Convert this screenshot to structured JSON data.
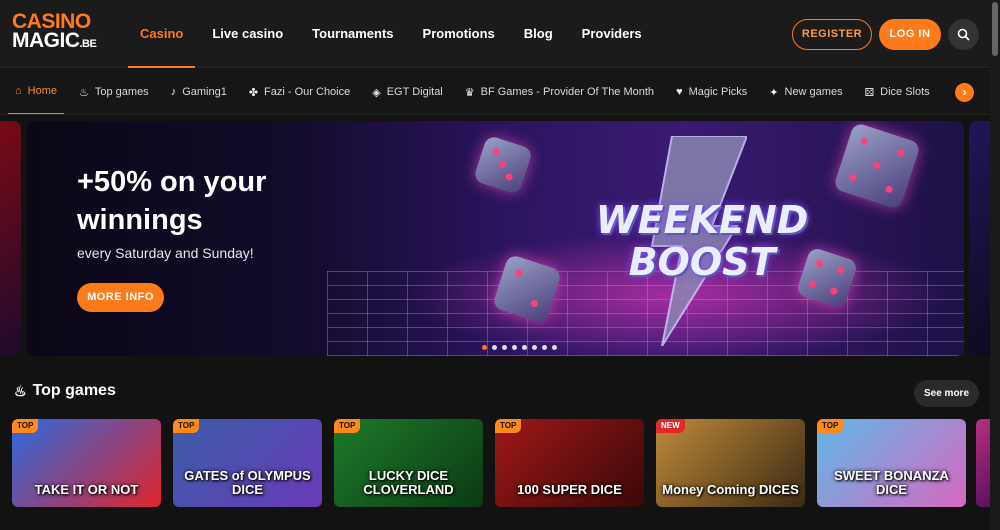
{
  "header": {
    "logo_line1": "CASINO",
    "logo_line2": "MAGIC",
    "logo_suffix": ".BE",
    "nav": [
      "Casino",
      "Live casino",
      "Tournaments",
      "Promotions",
      "Blog",
      "Providers"
    ],
    "register_label": "REGISTER",
    "login_label": "LOG IN",
    "search_icon": "search-icon"
  },
  "subnav": {
    "items": [
      {
        "label": "Home",
        "icon": "home-icon",
        "glyph": "⌂"
      },
      {
        "label": "Top games",
        "icon": "flame-icon",
        "glyph": "♨"
      },
      {
        "label": "Gaming1",
        "icon": "gaming1-icon",
        "glyph": "♪"
      },
      {
        "label": "Fazi - Our Choice",
        "icon": "clover-icon",
        "glyph": "✤"
      },
      {
        "label": "EGT Digital",
        "icon": "diamond-icon",
        "glyph": "◈"
      },
      {
        "label": "BF Games - Provider Of The Month",
        "icon": "trophy-icon",
        "glyph": "♛"
      },
      {
        "label": "Magic Picks",
        "icon": "heart-icon",
        "glyph": "♥"
      },
      {
        "label": "New games",
        "icon": "new-icon",
        "glyph": "✦"
      },
      {
        "label": "Dice Slots",
        "icon": "dice-icon",
        "glyph": "⚄"
      }
    ],
    "next_icon": "chevron-right-icon"
  },
  "hero": {
    "headline": "+50% on your winnings",
    "subtitle": "every Saturday and Sunday!",
    "cta": "MORE INFO",
    "art_line1": "WEEKEND",
    "art_line2": "BOOST",
    "slide_count": 8,
    "active_slide": 1
  },
  "top_games": {
    "title": "Top games",
    "see_more": "See more",
    "icon": "flame-icon",
    "games": [
      {
        "name": "TAKE IT OR NOT",
        "tag": "TOP",
        "colors": [
          "#2a6be0",
          "#e0242c"
        ]
      },
      {
        "name": "GATES of OLYMPUS DICE",
        "tag": "TOP",
        "colors": [
          "#3a5da8",
          "#6a3ab8"
        ]
      },
      {
        "name": "LUCKY DICE CLOVERLAND",
        "tag": "TOP",
        "colors": [
          "#1e7a2a",
          "#0c3a14"
        ]
      },
      {
        "name": "100 SUPER DICE",
        "tag": "TOP",
        "colors": [
          "#a01818",
          "#3a0808"
        ]
      },
      {
        "name": "Money Coming DICES",
        "tag": "NEW",
        "colors": [
          "#c08a3a",
          "#3a2a14"
        ]
      },
      {
        "name": "SWEET BONANZA DICE",
        "tag": "TOP",
        "colors": [
          "#5fb8e8",
          "#d868c0"
        ]
      }
    ]
  }
}
